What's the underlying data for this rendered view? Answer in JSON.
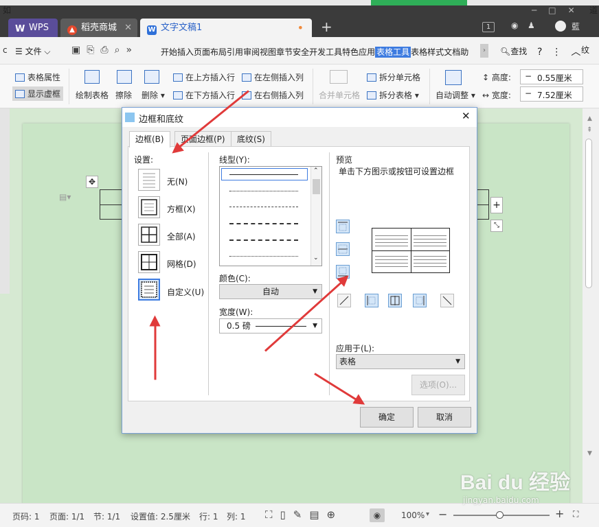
{
  "window": {
    "top_char_left": "如",
    "top_char_right": "道",
    "count": "1",
    "user": "藍",
    "edge_char": "纹"
  },
  "tabs": [
    {
      "label": "WPS"
    },
    {
      "label": "稻壳商城"
    },
    {
      "label": "文字文稿1"
    }
  ],
  "menubar": {
    "edge_char": "c",
    "file": "文件",
    "items": [
      "开始",
      "插入",
      "页面布局",
      "引用",
      "审阅",
      "视图",
      "章节",
      "安全",
      "开发工具",
      "特色应用",
      "表格工具",
      "表格样式",
      "文档助"
    ],
    "search": "查找"
  },
  "ribbon": {
    "table_props": "表格属性",
    "show_grid": "显示虚框",
    "draw_table": "绘制表格",
    "erase": "擦除",
    "delete": "删除",
    "insert_above": "在上方插入行",
    "insert_below": "在下方插入行",
    "insert_left": "在左侧插入列",
    "insert_right": "在右侧插入列",
    "merge": "合并单元格",
    "split_cells": "拆分单元格",
    "split_table": "拆分表格",
    "auto_fit": "自动调整",
    "height_label": "高度:",
    "height_value": "0.55厘米",
    "width_label": "宽度:",
    "width_value": "7.52厘米"
  },
  "dialog": {
    "title": "边框和底纹",
    "tabs": [
      "边框(B)",
      "页面边框(P)",
      "底纹(S)"
    ],
    "settings_label": "设置:",
    "settings": [
      "无(N)",
      "方框(X)",
      "全部(A)",
      "网格(D)",
      "自定义(U)"
    ],
    "line_style_label": "线型(Y):",
    "color_label": "颜色(C):",
    "color_value": "自动",
    "width_label": "宽度(W):",
    "width_value": "0.5  磅",
    "preview_label": "预览",
    "preview_hint": "单击下方图示或按钮可设置边框",
    "apply_to_label": "应用于(L):",
    "apply_to_value": "表格",
    "options": "选项(O)...",
    "ok": "确定",
    "cancel": "取消"
  },
  "status": {
    "page_no": "页码: 1",
    "page_count": "页面: 1/1",
    "section": "节: 1/1",
    "setting": "设置值: 2.5厘米",
    "row": "行: 1",
    "col": "列: 1",
    "zoom": "100%"
  },
  "watermark": {
    "logo": "Bai du 经验",
    "url": "jingyan.baidu.com"
  },
  "colors": {
    "accent": "#3d7be0",
    "doc_bg": "#c9e5c6",
    "arrow": "#e03a3a",
    "titlebar": "#3b3b3b"
  }
}
